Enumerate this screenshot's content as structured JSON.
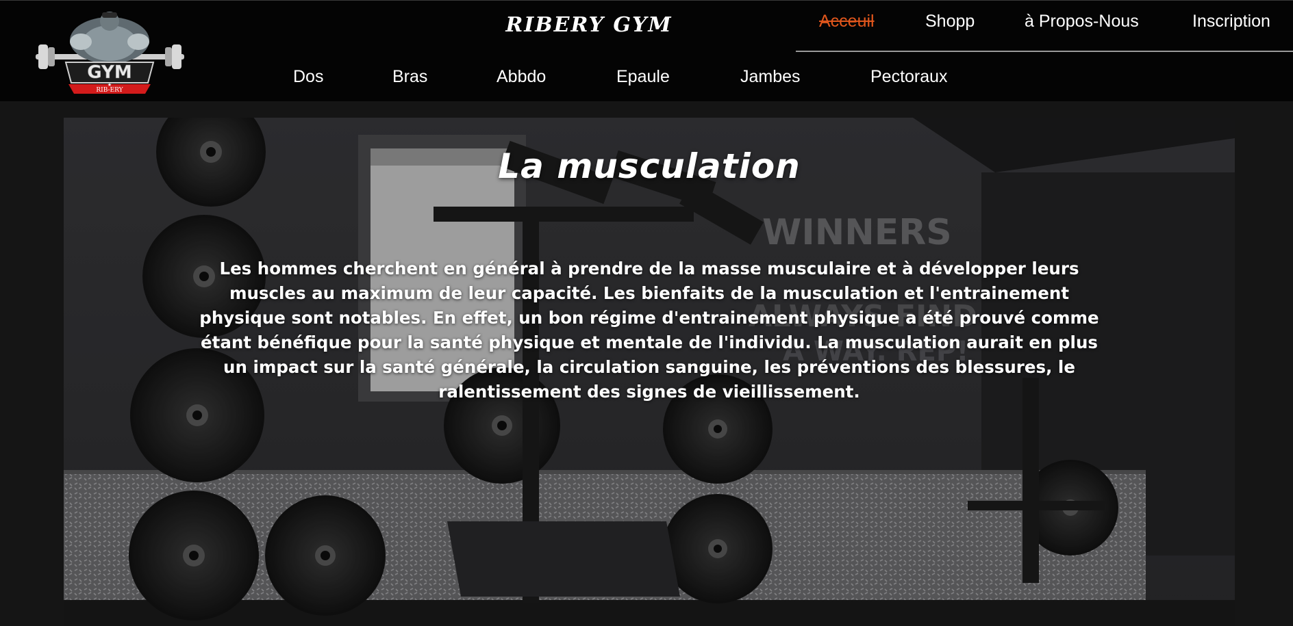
{
  "brand": {
    "site_title": "RIBERY GYM",
    "logo_text": "GYM",
    "logo_ribbon": "RIB-ERY"
  },
  "top_nav": [
    {
      "label": "Acceuil",
      "active": true
    },
    {
      "label": "Shopp",
      "active": false
    },
    {
      "label": "à Propos-Nous",
      "active": false
    },
    {
      "label": "Inscription",
      "active": false
    }
  ],
  "sub_nav": [
    {
      "label": "Dos"
    },
    {
      "label": "Bras"
    },
    {
      "label": "Abbdo"
    },
    {
      "label": "Epaule"
    },
    {
      "label": "Jambes"
    },
    {
      "label": "Pectoraux"
    }
  ],
  "hero": {
    "title": "La musculation",
    "text": "Les hommes cherchent en général à prendre de la masse musculaire et à développer leurs muscles au maximum de leur capacité. Les bienfaits de la musculation et l'entrainement physique sont notables. En effet, un bon régime d'entrainement physique a été prouvé comme étant bénéfique pour la santé physique et mentale de l'individu. La musculation aurait en plus un impact sur la santé générale, la circulation sanguine, les préventions des blessures, le ralentissement des signes de vieillissement.",
    "wall_text": [
      "WINNERS",
      "ALWAYS FIND",
      "A WAY. REP!"
    ]
  },
  "colors": {
    "header_bg": "#040404",
    "page_bg": "#151515",
    "active_link": "#e0561c",
    "text": "#ffffff"
  }
}
